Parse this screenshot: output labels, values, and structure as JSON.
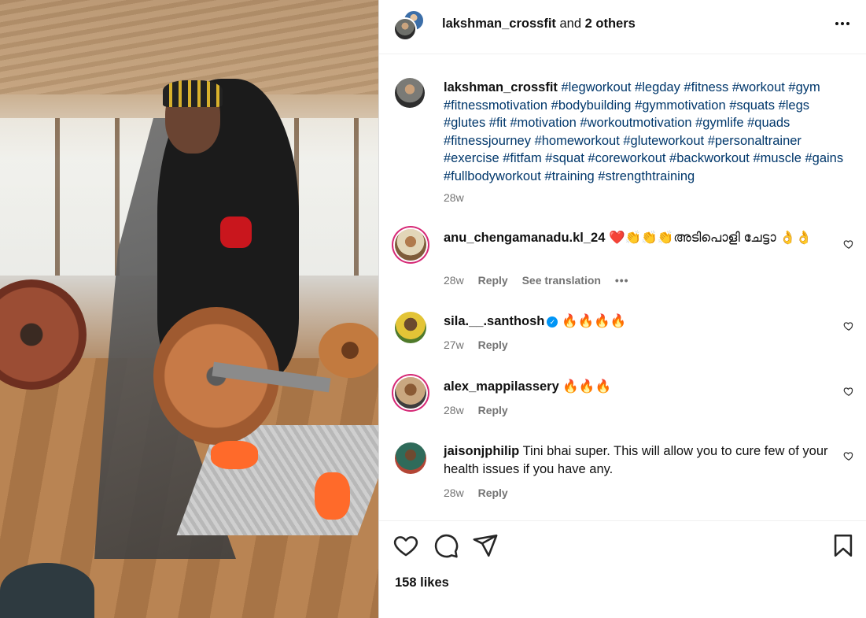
{
  "post": {
    "header": {
      "author": "lakshman_crossfit",
      "joiner": "and",
      "others": "2 others",
      "more_icon": "more-horizontal-icon"
    },
    "caption": {
      "username": "lakshman_crossfit",
      "hashtags": "#legworkout #legday #fitness #workout #gym #fitnessmotivation #bodybuilding #gymmotivation #squats #legs #glutes #fit #motivation #workoutmotivation #gymlife #quads #fitnessjourney #homeworkout #gluteworkout #personaltrainer #exercise #fitfam #squat #coreworkout #backworkout #muscle #gains #fullbodyworkout #training #strengthtraining",
      "time": "28w"
    },
    "comments": [
      {
        "username": "anu_chengamanadu.kl_24",
        "text": "❤️👏👏👏അടിപൊളി ചേട്ടാ 👌👌",
        "time": "28w",
        "reply": "Reply",
        "translation": "See translation",
        "more": "•••"
      },
      {
        "username": "sila.__.santhosh",
        "verified": "✓",
        "text": "🔥🔥🔥🔥",
        "time": "27w",
        "reply": "Reply"
      },
      {
        "username": "alex_mappilassery",
        "text": "🔥🔥🔥",
        "time": "28w",
        "reply": "Reply"
      },
      {
        "username": "jaisonjphilip",
        "text": "Tini bhai super. This will allow you to cure few of your health issues if you have any.",
        "time": "28w",
        "reply": "Reply"
      }
    ],
    "actions": {
      "like_icon": "heart-icon",
      "comment_icon": "comment-icon",
      "share_icon": "share-icon",
      "save_icon": "bookmark-icon"
    },
    "likes": "158 likes"
  },
  "colors": {
    "hashtag": "#00376b",
    "meta": "#737373",
    "ring": "#d62976",
    "verified": "#0095f6"
  }
}
